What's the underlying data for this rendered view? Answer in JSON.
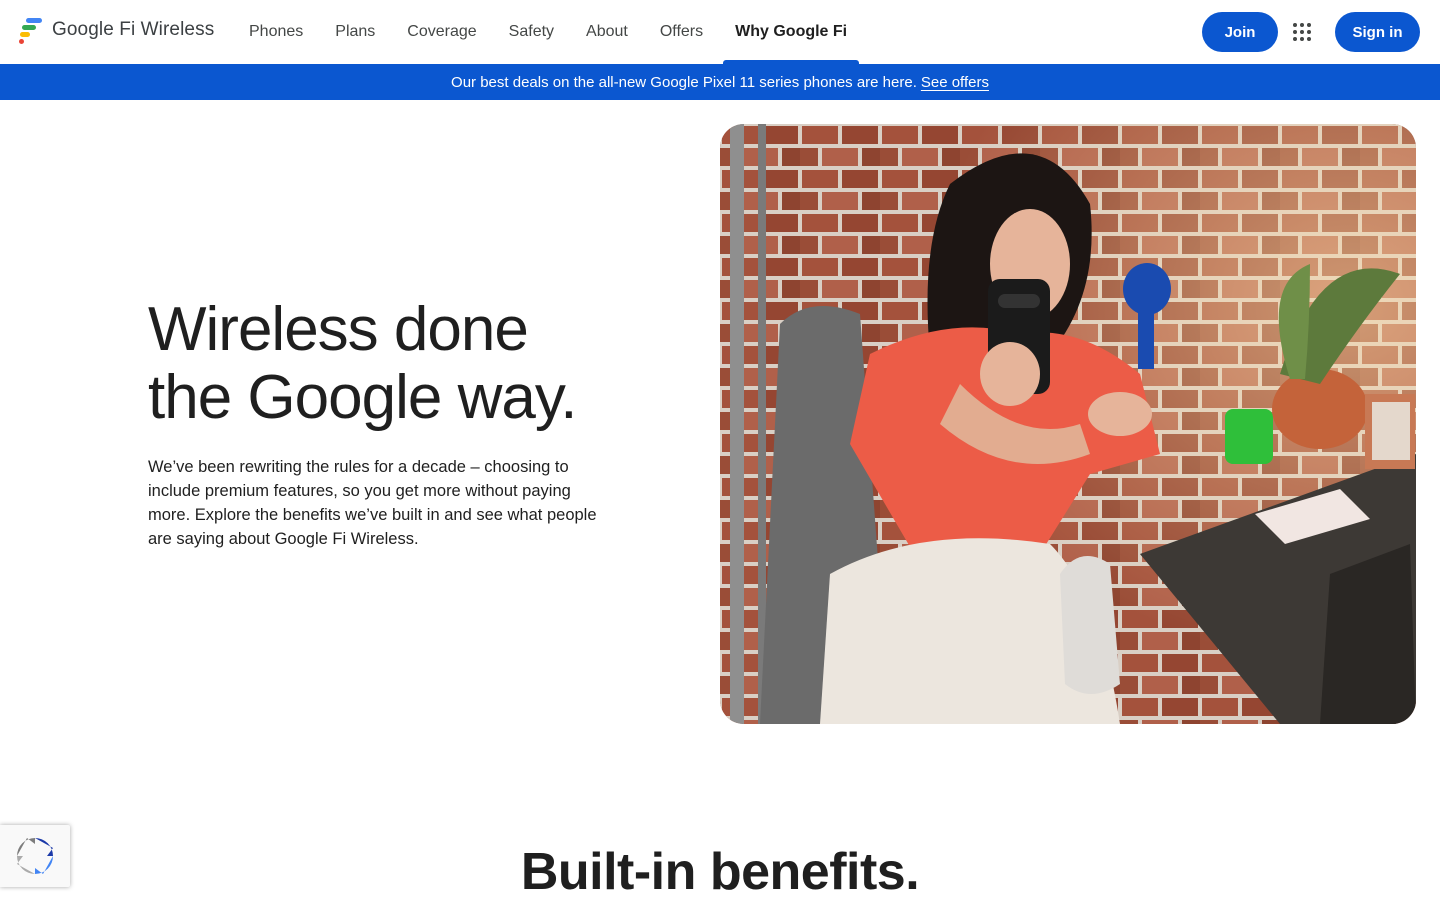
{
  "header": {
    "logo_text": "Google Fi Wireless",
    "nav": [
      {
        "label": "Phones",
        "active": false
      },
      {
        "label": "Plans",
        "active": false
      },
      {
        "label": "Coverage",
        "active": false
      },
      {
        "label": "Safety",
        "active": false
      },
      {
        "label": "About",
        "active": false
      },
      {
        "label": "Offers",
        "active": false
      },
      {
        "label": "Why Google Fi",
        "active": true
      }
    ],
    "join_label": "Join",
    "apps_icon": "google-apps-grid-icon",
    "signin_label": "Sign in"
  },
  "banner": {
    "text": "Our best deals on the all-new Google Pixel 11 series phones are here.",
    "link_label": "See offers"
  },
  "hero": {
    "title_line1": "Wireless done",
    "title_line2": "the Google way.",
    "body": "We’ve been rewriting the rules for a decade – choosing to include premium features, so you get more without paying more. Explore the benefits we’ve built in and see what people are saying about Google Fi Wireless.",
    "image_icon": "woman-with-phone-photo"
  },
  "section": {
    "title": "Built-in benefits."
  },
  "recaptcha_icon": "recaptcha-icon",
  "colors": {
    "brand_blue": "#0b57d0",
    "text_primary": "#1f1f1f",
    "nav_text": "#444746"
  }
}
